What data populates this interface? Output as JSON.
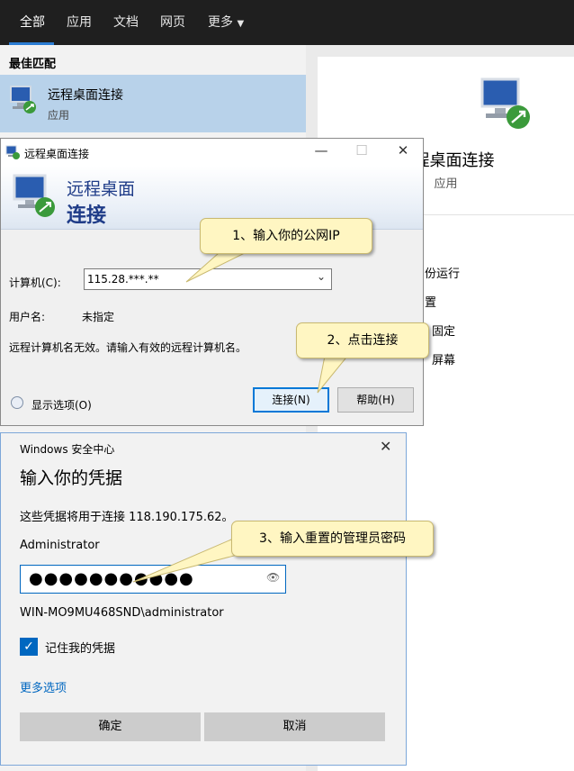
{
  "search": {
    "tabs": [
      "全部",
      "应用",
      "文档",
      "网页",
      "更多"
    ],
    "best_match_label": "最佳匹配",
    "best_match_title": "远程桌面连接",
    "best_match_sub": "应用",
    "detail_title": "远程桌面连接",
    "detail_sub": "应用",
    "actions_partial": [
      "份运行",
      "置",
      "固定",
      "屏幕"
    ]
  },
  "rdp": {
    "window_title": "远程桌面连接",
    "banner_line1": "远程桌面",
    "banner_line2": "连接",
    "computer_label": "计算机(C):",
    "computer_value": "115.28.***.**",
    "username_label": "用户名:",
    "username_value": "未指定",
    "warning": "远程计算机名无效。请输入有效的远程计算机名。",
    "show_options": "显示选项(O)",
    "connect_button": "连接(N)",
    "help_button": "帮助(H)"
  },
  "security": {
    "app_name": "Windows 安全中心",
    "heading": "输入你的凭据",
    "description": "这些凭据将用于连接 118.190.175.62。",
    "username": "Administrator",
    "password_mask": "●●●●●●●●●●●",
    "account": "WIN-MO9MU468SND\\administrator",
    "remember_label": "记住我的凭据",
    "more_options": "更多选项",
    "ok_button": "确定",
    "cancel_button": "取消"
  },
  "callouts": {
    "step1": "1、输入你的公网IP",
    "step2": "2、点击连接",
    "step3": "3、输入重置的管理员密码"
  },
  "icons": {
    "rdp": "remote-desktop-icon",
    "dropdown": "chevron-down-icon",
    "close": "close-icon",
    "eye": "eye-icon",
    "check": "checkmark-icon"
  },
  "colors": {
    "accent": "#0067c0",
    "selection": "#b8d2ea",
    "callout_bg": "#fff6c2",
    "banner_text": "#1f3c88"
  }
}
